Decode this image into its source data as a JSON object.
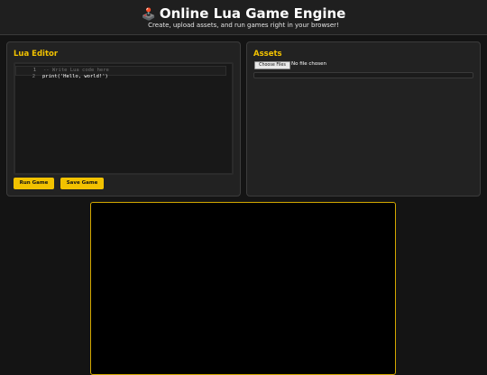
{
  "header": {
    "icon": "joystick-icon",
    "title": "Online Lua Game Engine",
    "subtitle": "Create, upload assets, and run games right in your browser!"
  },
  "editor": {
    "title": "Lua Editor",
    "lines": [
      {
        "number": "1",
        "text": "-- Write Lua code here"
      },
      {
        "number": "2",
        "fn": "print(",
        "str": "'Hello, world!'",
        "end": ")"
      }
    ],
    "run_label": "Run Game",
    "save_label": "Save Game"
  },
  "assets": {
    "title": "Assets",
    "file_button": "Choose Files",
    "file_status": "No file chosen"
  },
  "colors": {
    "accent": "#f2c200",
    "background": "#141414",
    "panel": "#222222",
    "canvas": "#000000"
  }
}
